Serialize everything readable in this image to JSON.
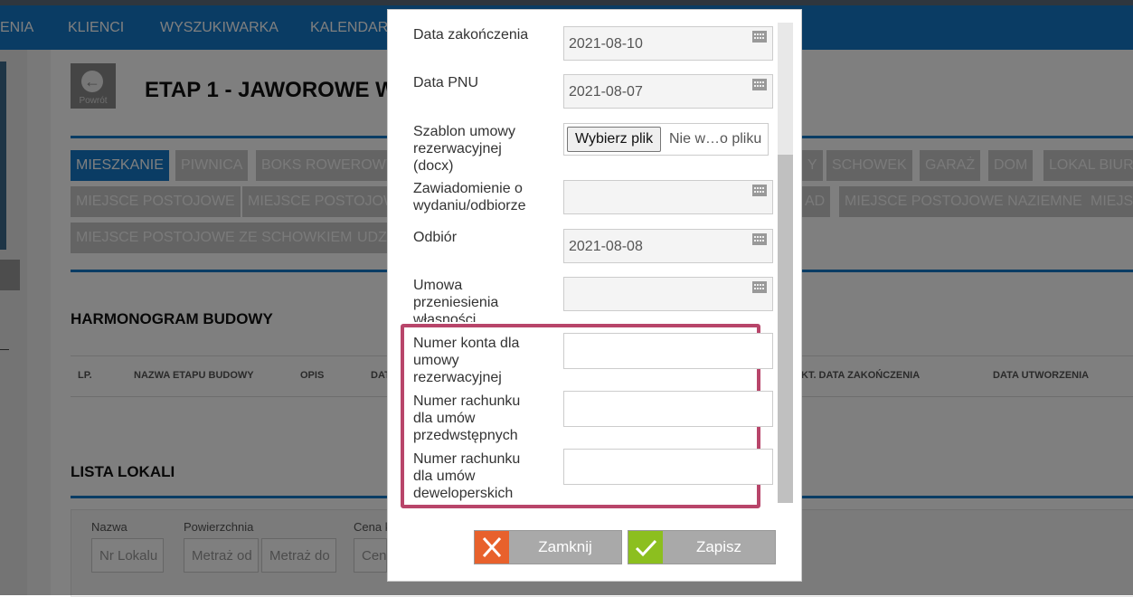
{
  "nav": {
    "items": [
      "ENIA",
      "KLIENCI",
      "WYSZUKIWARKA",
      "KALENDARZ"
    ]
  },
  "header": {
    "back_label": "Powrót",
    "title": "ETAP 1 - JAWOROWE W"
  },
  "tabs": {
    "row1": [
      "MIESZKANIE",
      "PIWNICA",
      "BOKS ROWEROWY",
      "Y",
      "SCHOWEK",
      "GARAŻ",
      "DOM",
      "LOKAL BIUR"
    ],
    "row2": [
      "MIEJSCE POSTOJOWE",
      "MIEJSCE POSTOJOW",
      "AD",
      "MIEJSCE POSTOJOWE NAZIEMNE",
      "MIEJS"
    ],
    "row3": [
      "MIEJSCE POSTOJOWE ZE SCHOWKIEM",
      "UDZ"
    ]
  },
  "harmonogram": {
    "title": "HARMONOGRAM BUDOWY",
    "columns": [
      "LP.",
      "NAZWA ETAPU BUDOWY",
      "OPIS",
      "DAT",
      "KT. DATA ZAKOŃCZENIA",
      "DATA UTWORZENIA"
    ]
  },
  "lokale": {
    "title": "LISTA LOKALI",
    "filters": {
      "nazwa_label": "Nazwa",
      "nazwa_placeholder": "Nr Lokalu",
      "powierzchnia_label": "Powierzchnia",
      "metraz_od": "Metraż od",
      "metraz_do": "Metraż do",
      "cena_label": "Cena k",
      "cena_placeholder": "Cen"
    }
  },
  "modal": {
    "fields": {
      "data_zakonczenia": {
        "label": "Data zakończenia",
        "value": "2021-08-10"
      },
      "data_pnu": {
        "label": "Data PNU",
        "value": "2021-08-07"
      },
      "szablon": {
        "label": "Szablon umowy rezerwacyjnej (docx)",
        "button": "Wybierz plik",
        "file_status": "Nie w…o pliku"
      },
      "zawiadomienie": {
        "label": "Zawiadomienie o wydaniu/odbiorze",
        "value": ""
      },
      "odbior": {
        "label": "Odbiór",
        "value": "2021-08-08"
      },
      "umowa": {
        "label": "Umowa przeniesienia własności",
        "value": ""
      },
      "konto_rezerwacyjnej": {
        "label": "Numer konta dla umowy rezerwacyjnej",
        "value": ""
      },
      "rachunek_przedwstepnych": {
        "label": "Numer rachunku dla umów przedwstępnych",
        "value": ""
      },
      "rachunek_deweloperskich": {
        "label": "Numer rachunku dla umów deweloperskich",
        "value": ""
      }
    },
    "buttons": {
      "close": "Zamknij",
      "save": "Zapisz"
    }
  },
  "colors": {
    "primary_blue": "#1479c9",
    "highlight": "#b8456a",
    "close_orange": "#e8612c",
    "save_green": "#8cbf1f"
  }
}
